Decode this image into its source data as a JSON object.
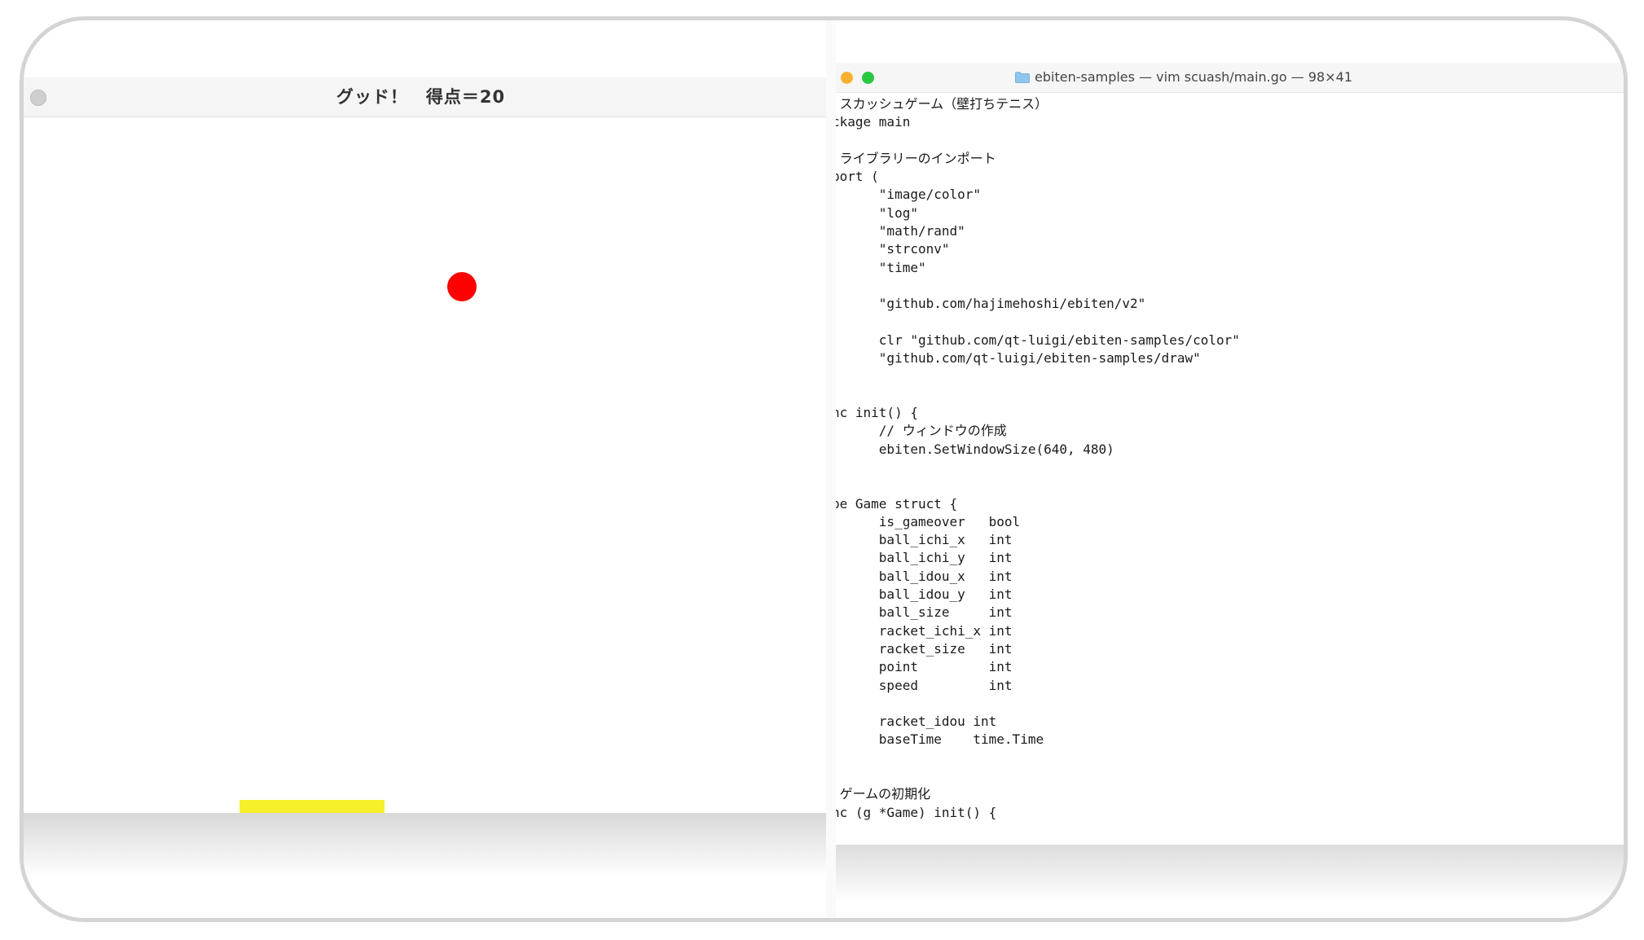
{
  "game_window": {
    "title": "グッド！　得点＝20",
    "ball_color": "#ff0000",
    "racket_color": "#f5f02a",
    "close_button_color": "#cfcfcf"
  },
  "terminal_window": {
    "title": "ebiten-samples — vim scuash/main.go — 98×41",
    "icons": {
      "minimize": "minimize-dot-yellow",
      "maximize": "maximize-dot-green",
      "folder": "folder-icon"
    },
    "colors": {
      "minimize": "#f7b12f",
      "maximize": "#2ac840",
      "folder": "#8ec6ef"
    },
    "code_lines": [
      " スカッシュゲーム（壁打ちテニス）",
      "ckage main",
      "",
      " ライブラリーのインポート",
      "port (",
      "      \"image/color\"",
      "      \"log\"",
      "      \"math/rand\"",
      "      \"strconv\"",
      "      \"time\"",
      "",
      "      \"github.com/hajimehoshi/ebiten/v2\"",
      "",
      "      clr \"github.com/qt-luigi/ebiten-samples/color\"",
      "      \"github.com/qt-luigi/ebiten-samples/draw\"",
      "",
      "",
      "nc init() {",
      "      // ウィンドウの作成",
      "      ebiten.SetWindowSize(640, 480)",
      "",
      "",
      "pe Game struct {",
      "      is_gameover   bool",
      "      ball_ichi_x   int",
      "      ball_ichi_y   int",
      "      ball_idou_x   int",
      "      ball_idou_y   int",
      "      ball_size     int",
      "      racket_ichi_x int",
      "      racket_size   int",
      "      point         int",
      "      speed         int",
      "",
      "      racket_idou int",
      "      baseTime    time.Time",
      "",
      "",
      " ゲームの初期化",
      "nc (g *Game) init() {"
    ]
  }
}
